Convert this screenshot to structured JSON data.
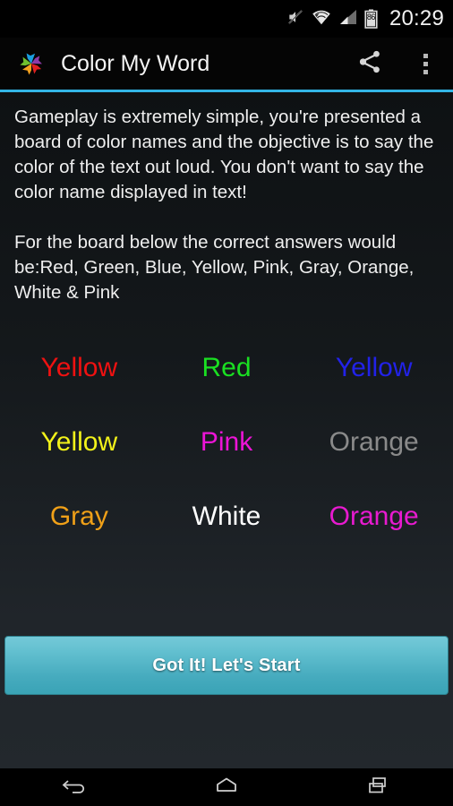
{
  "status_bar": {
    "mute_icon": "ringer-muted-icon",
    "wifi_icon": "wifi-icon",
    "signal_icon": "cell-signal-icon",
    "battery_icon": "battery-icon",
    "battery_level": "86",
    "clock": "20:29"
  },
  "action_bar": {
    "app_icon": "pinwheel-app-icon",
    "title": "Color My Word",
    "share_icon": "share-icon",
    "overflow_icon": "overflow-menu-icon",
    "underline_color": "#33b5e5"
  },
  "intro": {
    "paragraph1": "Gameplay is extremely simple, you're presented a board of color names and the objective is to say the color of the text out loud. You don't want to say the color name displayed in text!",
    "paragraph2": "For the board below the correct answers would be:Red, Green, Blue, Yellow, Pink, Gray, Orange, White & Pink"
  },
  "board": {
    "rows": [
      [
        {
          "word": "Yellow",
          "color": "#ef1111"
        },
        {
          "word": "Red",
          "color": "#1ae022"
        },
        {
          "word": "Yellow",
          "color": "#2222e8"
        }
      ],
      [
        {
          "word": "Yellow",
          "color": "#f2f21a"
        },
        {
          "word": "Pink",
          "color": "#ec14d6"
        },
        {
          "word": "Orange",
          "color": "#8a8a8a"
        }
      ],
      [
        {
          "word": "Gray",
          "color": "#f0a018"
        },
        {
          "word": "White",
          "color": "#ffffff"
        },
        {
          "word": "Orange",
          "color": "#e81ad0"
        }
      ]
    ]
  },
  "start_button": {
    "label": "Got It! Let's Start",
    "color": "#4eb3c4"
  },
  "nav_bar": {
    "back_icon": "back-icon",
    "home_icon": "home-icon",
    "recents_icon": "recent-apps-icon"
  }
}
